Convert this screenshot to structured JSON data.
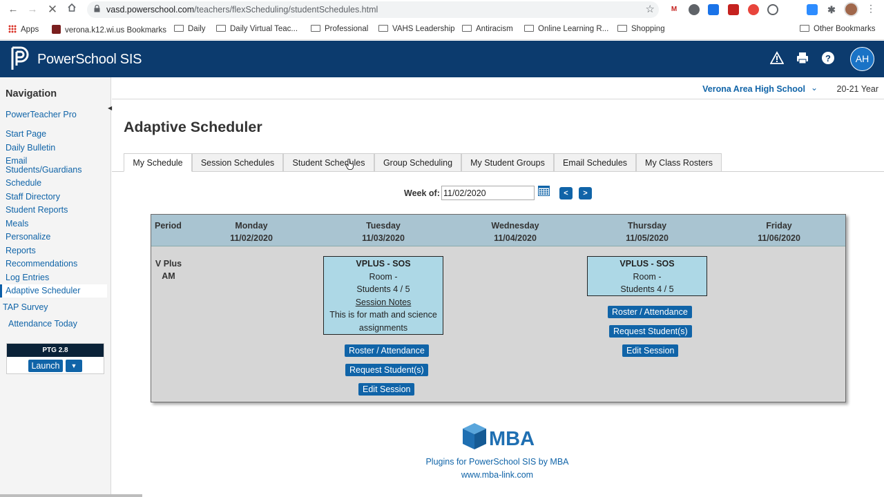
{
  "browser": {
    "url_domain": "vasd.powerschool.com",
    "url_path": "/teachers/flexScheduling/studentSchedules.html",
    "bookmarks": [
      "Apps",
      "verona.k12.wi.us Bookmarks",
      "Daily",
      "Daily Virtual Teac...",
      "Professional",
      "VAHS Leadership",
      "Antiracism",
      "Online Learning R...",
      "Shopping",
      "Other Bookmarks"
    ],
    "ext_gmail": "M"
  },
  "header": {
    "app_title": "PowerSchool SIS",
    "avatar_initials": "AH"
  },
  "sidebar": {
    "heading": "Navigation",
    "items": [
      "PowerTeacher Pro",
      "Start Page",
      "Daily Bulletin",
      "Email Students/Guardians",
      "Schedule",
      "Staff Directory",
      "Student Reports",
      "Meals",
      "Personalize",
      "Reports",
      "Recommendations",
      "Log Entries",
      "Adaptive Scheduler",
      "TAP Survey",
      "Attendance Today"
    ],
    "active_item": "Adaptive Scheduler",
    "ptg_title": "PTG 2.8",
    "launch_label": "Launch"
  },
  "school_bar": {
    "school": "Verona Area High School",
    "year": "20-21 Year"
  },
  "page": {
    "title": "Adaptive Scheduler",
    "tabs": [
      "My Schedule",
      "Session Schedules",
      "Student Schedules",
      "Group Scheduling",
      "My Student Groups",
      "Email Schedules",
      "My Class Rosters"
    ],
    "active_tab": "My Schedule"
  },
  "week": {
    "label": "Week of:",
    "value": "11/02/2020",
    "prev": "<",
    "next": ">"
  },
  "schedule": {
    "period_header": "Period",
    "days": [
      {
        "name": "Monday",
        "date": "11/02/2020"
      },
      {
        "name": "Tuesday",
        "date": "11/03/2020"
      },
      {
        "name": "Wednesday",
        "date": "11/04/2020"
      },
      {
        "name": "Thursday",
        "date": "11/05/2020"
      },
      {
        "name": "Friday",
        "date": "11/06/2020"
      }
    ],
    "period_name": "V Plus AM",
    "tuesday_session": {
      "title": "VPLUS - SOS",
      "room": "Room -",
      "students": "Students 4 / 5",
      "notes_link": "Session Notes",
      "note": "This is for math and science assignments"
    },
    "thursday_session": {
      "title": "VPLUS - SOS",
      "room": "Room -",
      "students": "Students 4 / 5"
    },
    "btn_roster": "Roster / Attendance",
    "btn_request": "Request Student(s)",
    "btn_edit": "Edit Session"
  },
  "footer": {
    "logo_text": "MBA",
    "plugins": "Plugins for PowerSchool SIS by MBA",
    "site": "www.mba-link.com"
  },
  "colors": {
    "header_bg": "#0c3b6e",
    "accent_blue": "#1064a8",
    "grid_head": "#a9c4d1",
    "session_bg": "#add8e6"
  }
}
